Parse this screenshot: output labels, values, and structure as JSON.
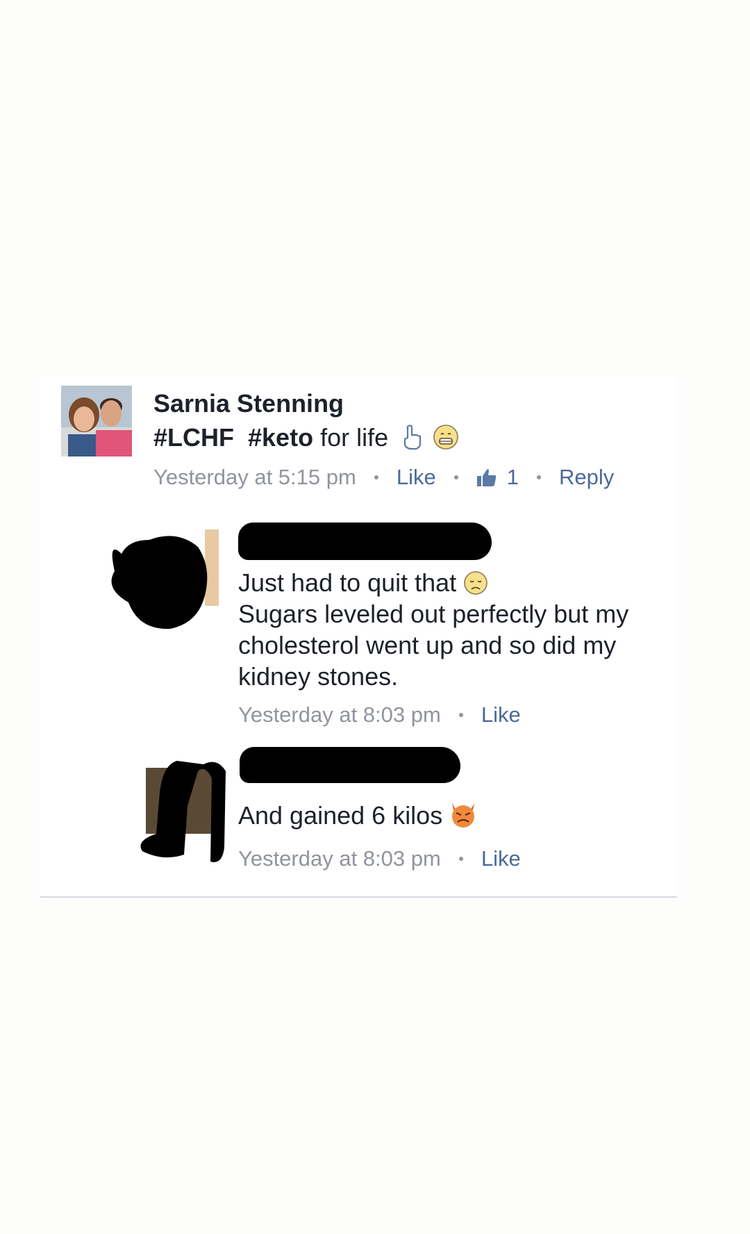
{
  "post": {
    "author": "Sarnia Stenning",
    "hashtag1": "#LCHF",
    "hashtag2": "#keto",
    "text_tail": "for life",
    "emoji1": "pointing-down-hand-icon",
    "emoji2": "grinning-face-icon",
    "timestamp": "Yesterday at 5:15 pm",
    "like_label": "Like",
    "like_count": "1",
    "reply_label": "Reply"
  },
  "comments": [
    {
      "author": "[redacted]",
      "lines": [
        "Just had to quit that",
        "Sugars leveled out perfectly but my",
        "cholesterol went up and so did my",
        "kidney stones."
      ],
      "emoji": "disappointed-face-icon",
      "timestamp": "Yesterday at 8:03 pm",
      "like_label": "Like"
    },
    {
      "author": "[redacted]",
      "lines": [
        "And gained 6 kilos"
      ],
      "emoji": "devil-face-icon",
      "timestamp": "Yesterday at 8:03 pm",
      "like_label": "Like"
    }
  ],
  "colors": {
    "text": "#1d2129",
    "meta": "#90949c",
    "link": "#4b6a9b",
    "divider": "#d5dbe3"
  }
}
